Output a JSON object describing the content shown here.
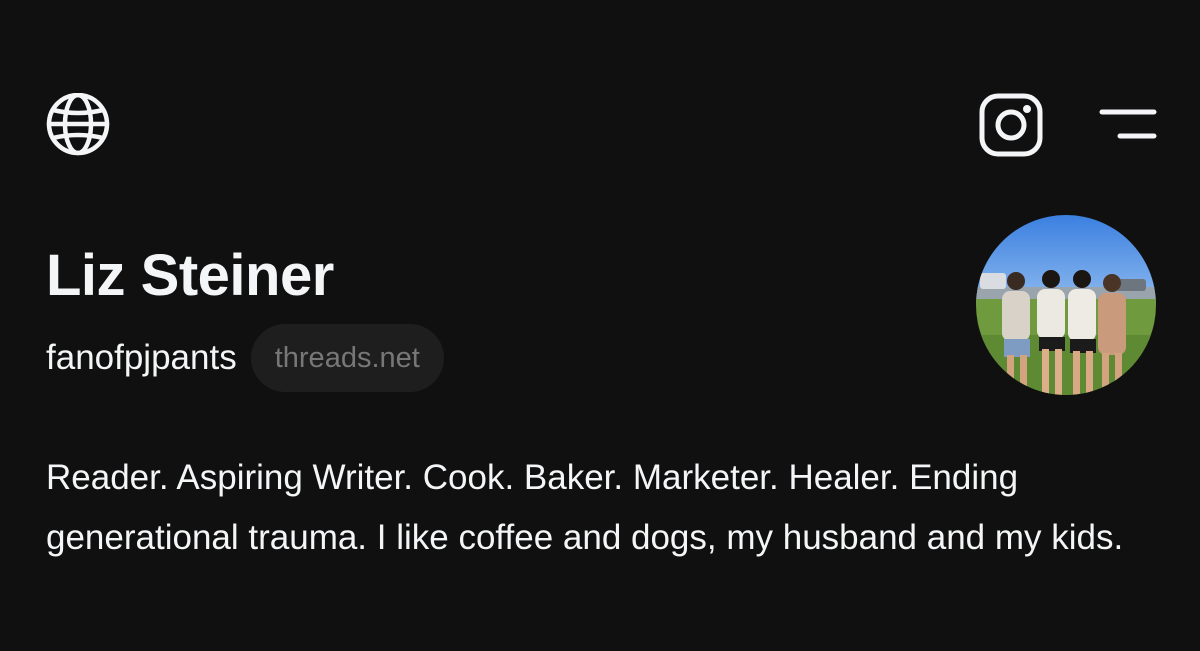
{
  "header": {
    "left_icon": "globe-icon",
    "right_icons": [
      "instagram-icon",
      "menu-icon"
    ]
  },
  "profile": {
    "display_name": "Liz Steiner",
    "username": "fanofpjpants",
    "domain_badge": "threads.net",
    "avatar_alt": "Profile photo of four women standing on grass",
    "bio": "Reader. Aspiring Writer. Cook. Baker. Marketer. Healer. Ending generational trauma. I like coffee and dogs, my husband and my kids."
  },
  "colors": {
    "background": "#101010",
    "text_primary": "#f3f5f7",
    "pill_background": "#1e1e1e",
    "pill_text": "#777777"
  }
}
